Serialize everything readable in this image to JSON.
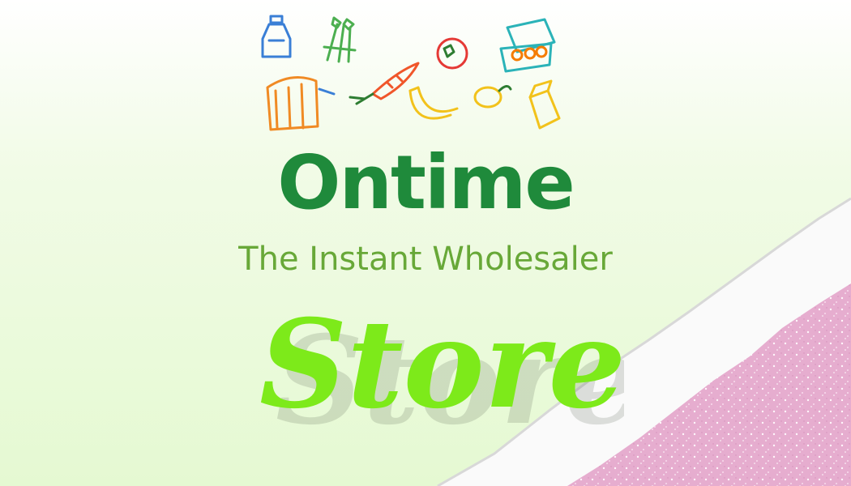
{
  "brand": {
    "name": "Ontime",
    "tagline": "The Instant Wholesaler",
    "script_word": "Store"
  },
  "colors": {
    "brand_green": "#1f8a3b",
    "tagline_green": "#68a838",
    "script_lime": "#7dea1a",
    "glitter_pink": "#e9b3d2"
  },
  "icons": [
    "milk-bottle-icon",
    "asparagus-icon",
    "tomato-icon",
    "egg-carton-icon",
    "bread-icon",
    "carrot-icon",
    "banana-icon",
    "lemon-icon",
    "juice-carton-icon"
  ]
}
